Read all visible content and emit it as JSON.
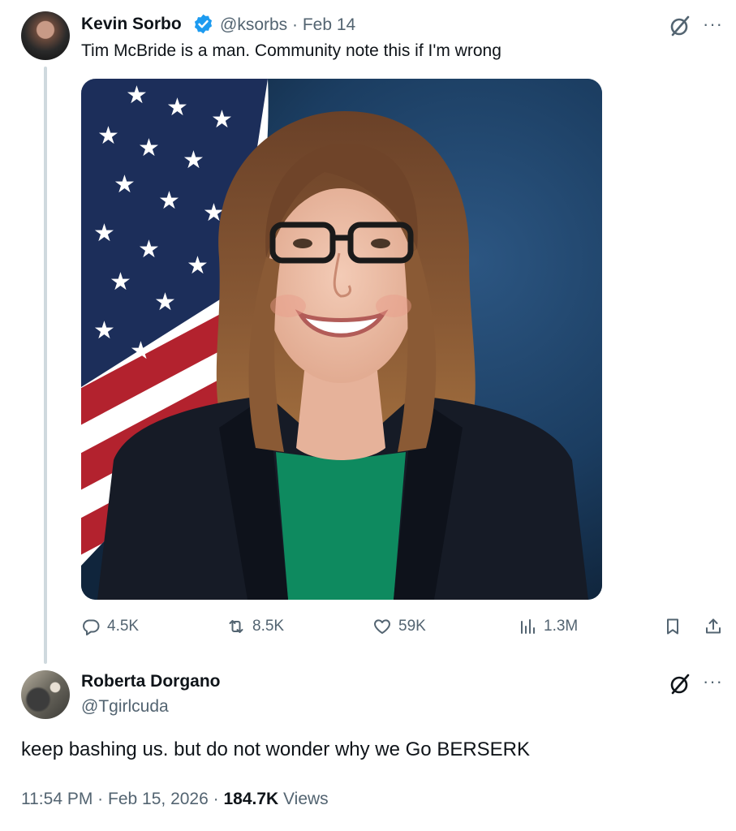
{
  "tweet1": {
    "author_name": "Kevin Sorbo",
    "handle": "@ksorbs",
    "separator": "·",
    "date": "Feb 14",
    "text": "Tim McBride is a man. Community note this if I'm wrong",
    "more_label": "···",
    "stats": {
      "replies": "4.5K",
      "reposts": "8.5K",
      "likes": "59K",
      "views": "1.3M"
    }
  },
  "tweet2": {
    "author_name": "Roberta Dorgano",
    "handle": "@Tgirlcuda",
    "more_label": "···",
    "text": "keep bashing us. but do not wonder why we Go BERSERK",
    "time": "11:54 PM",
    "separator": "·",
    "date": "Feb 15, 2026",
    "views_count": "184.7K",
    "views_label": "Views"
  },
  "colors": {
    "verified": "#1d9bf0",
    "secondary_text": "#536471",
    "primary_text": "#0f1419",
    "thread_line": "#cfd9de"
  },
  "icons": {
    "verified": "verified-badge-icon",
    "grok": "grok-icon",
    "more": "more-icon",
    "reply": "reply-icon",
    "repost": "repost-icon",
    "like": "heart-icon",
    "views": "views-icon",
    "bookmark": "bookmark-icon",
    "share": "share-icon"
  }
}
